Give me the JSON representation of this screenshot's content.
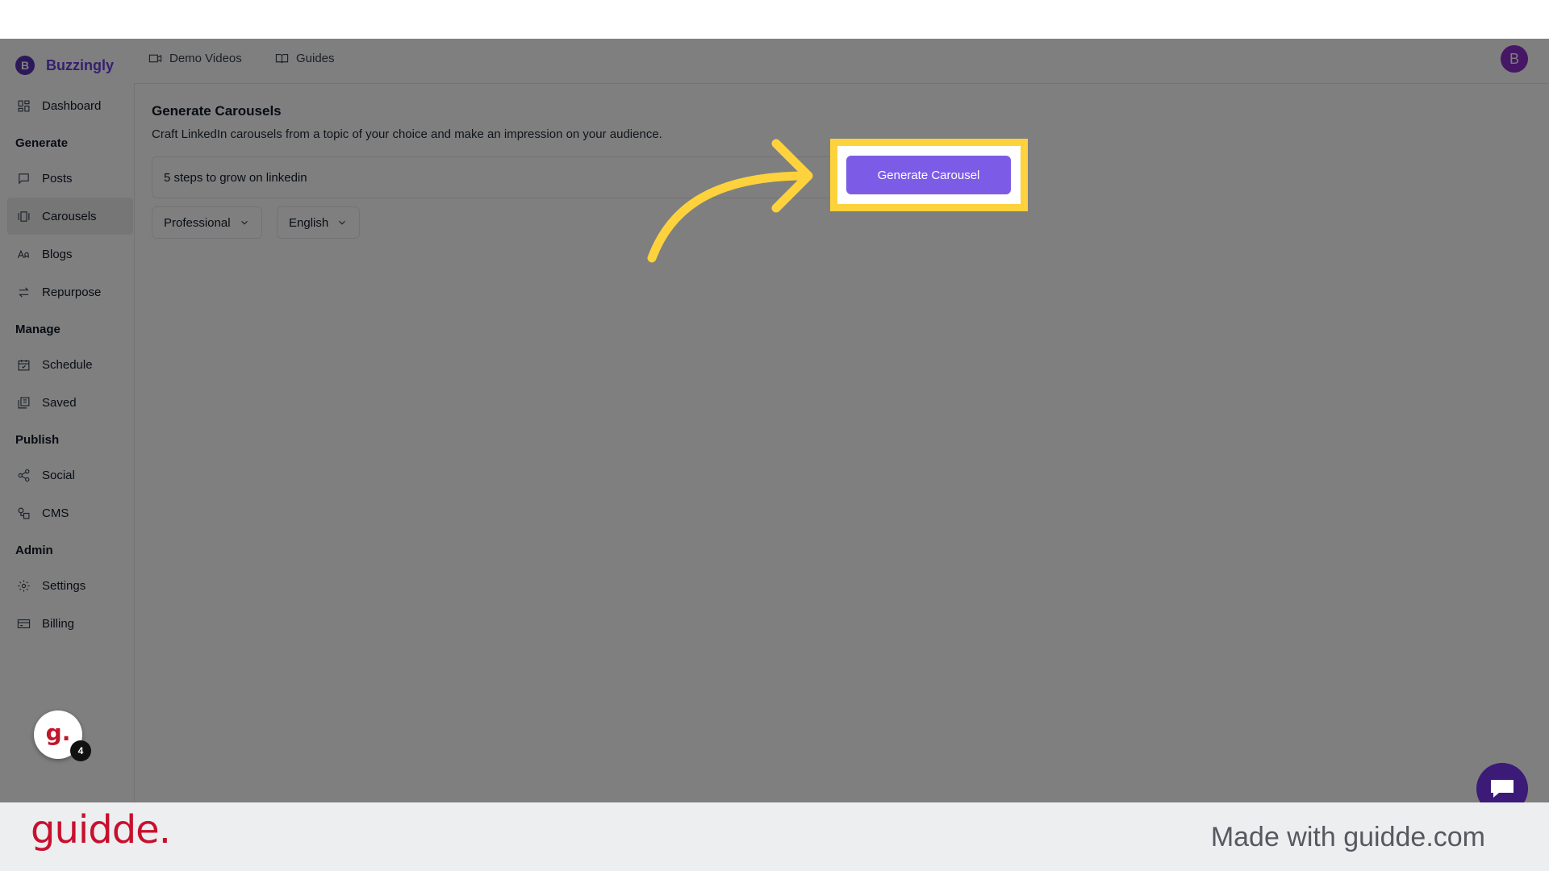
{
  "brand": {
    "badge": "B",
    "name": "Buzzingly"
  },
  "sidebar": {
    "dashboard": "Dashboard",
    "sections": {
      "generate": "Generate",
      "manage": "Manage",
      "publish": "Publish",
      "admin": "Admin"
    },
    "items": {
      "posts": "Posts",
      "carousels": "Carousels",
      "blogs": "Blogs",
      "repurpose": "Repurpose",
      "schedule": "Schedule",
      "saved": "Saved",
      "social": "Social",
      "cms": "CMS",
      "settings": "Settings",
      "billing": "Billing"
    },
    "active_item": "Carousels"
  },
  "header": {
    "demo_videos": "Demo Videos",
    "guides": "Guides",
    "avatar_initial": "B"
  },
  "main": {
    "title": "Generate Carousels",
    "subtitle": "Craft LinkedIn carousels from a topic of your choice and make an impression on your audience.",
    "topic_value": "5 steps to grow on linkedin",
    "tone_select": "Professional",
    "language_select": "English",
    "generate_button": "Generate Carousel"
  },
  "overlay": {
    "highlight_color": "#fdd23c",
    "guidde_badge_glyph": "g.",
    "guidde_badge_count": "4"
  },
  "footer": {
    "logo": "guidde.",
    "made_with": "Made with guidde.com"
  },
  "colors": {
    "brand_purple": "#6d3fe0",
    "button_purple": "#7c5ce6",
    "guidde_red": "#c8102e"
  }
}
